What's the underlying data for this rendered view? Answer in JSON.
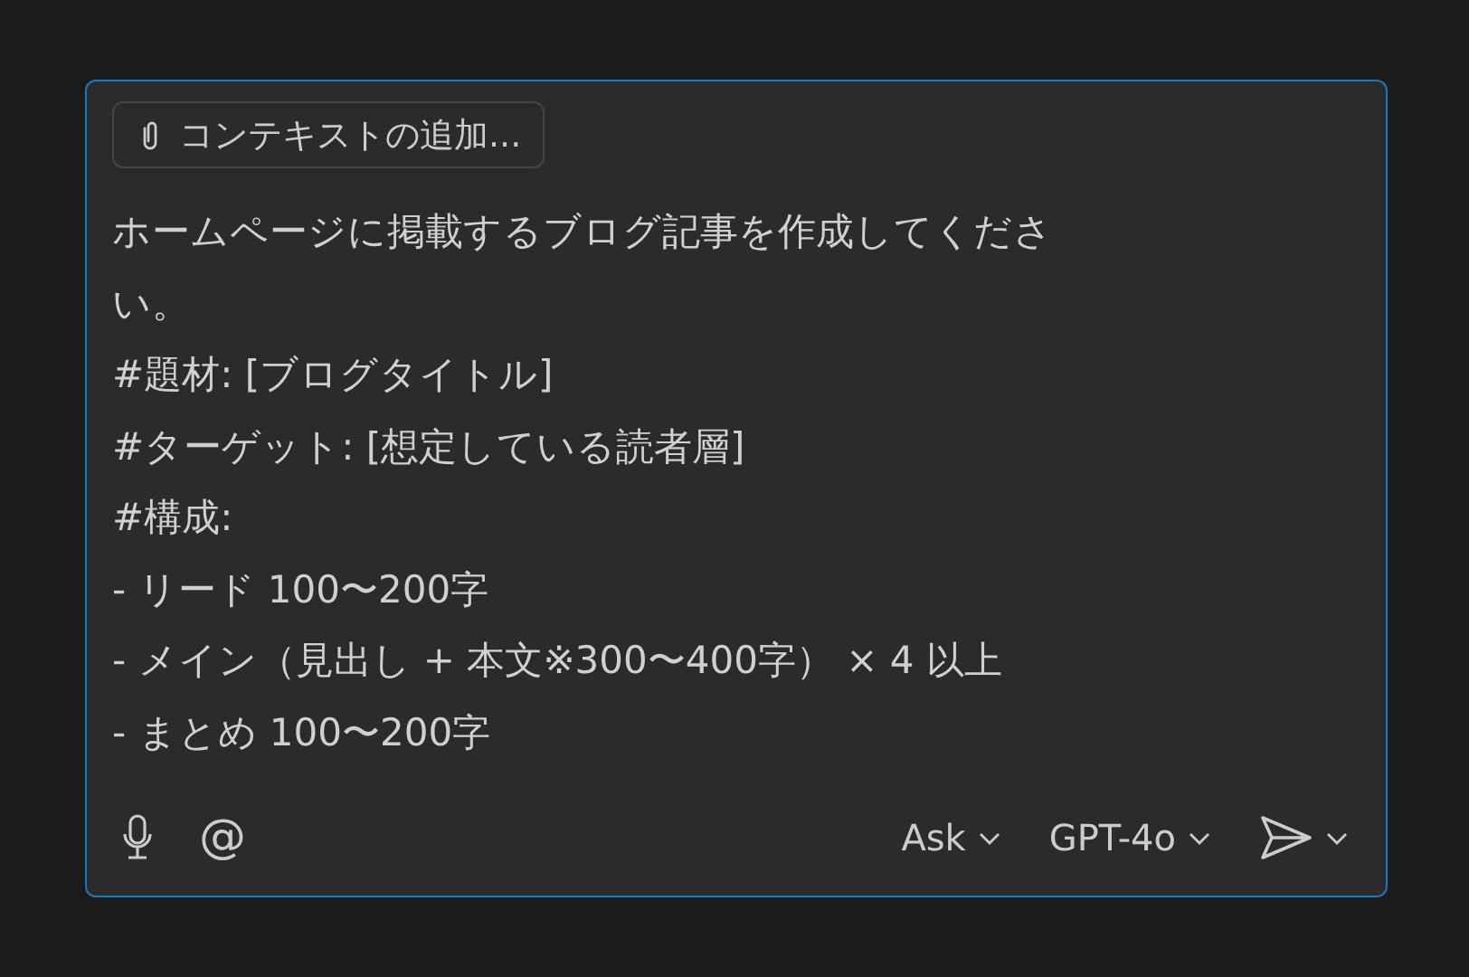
{
  "context_button": {
    "label": "コンテキストの追加..."
  },
  "prompt": {
    "lines": [
      "ホームページに掲載するブログ記事を作成してくださ",
      "い。",
      "#題材: [ブログタイトル]",
      "#ターゲット: [想定している読者層]",
      "#構成:",
      "- リード 100〜200字",
      "- メイン（見出し + 本文※300〜400字） × 4 以上",
      "- まとめ 100〜200字"
    ]
  },
  "toolbar": {
    "left": [
      {
        "kind": "mic"
      },
      {
        "kind": "mention",
        "label": "@"
      }
    ],
    "mode": {
      "label": "Ask"
    },
    "model": {
      "label": "GPT-4o"
    }
  }
}
